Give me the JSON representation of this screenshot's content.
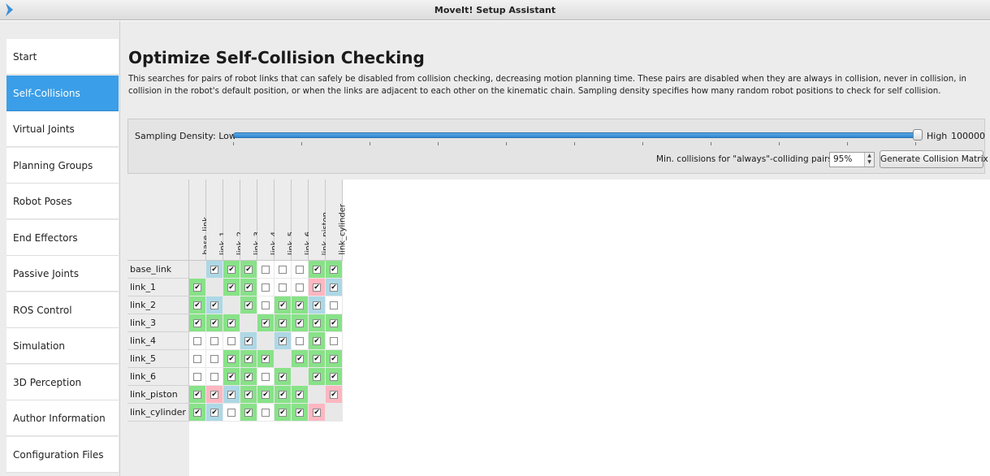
{
  "window": {
    "title": "MoveIt! Setup Assistant",
    "app_icon": "chevron-right-icon",
    "icon_color": "#3b8fd6"
  },
  "sidebar": {
    "items": [
      {
        "label": "Start",
        "active": false
      },
      {
        "label": "Self-Collisions",
        "active": true
      },
      {
        "label": "Virtual Joints",
        "active": false
      },
      {
        "label": "Planning Groups",
        "active": false
      },
      {
        "label": "Robot Poses",
        "active": false
      },
      {
        "label": "End Effectors",
        "active": false
      },
      {
        "label": "Passive Joints",
        "active": false
      },
      {
        "label": "ROS Control",
        "active": false
      },
      {
        "label": "Simulation",
        "active": false
      },
      {
        "label": "3D Perception",
        "active": false
      },
      {
        "label": "Author Information",
        "active": false
      },
      {
        "label": "Configuration Files",
        "active": false
      }
    ],
    "active_color": "#3b9ee8"
  },
  "main": {
    "title": "Optimize Self-Collision Checking",
    "description": "This searches for pairs of robot links that can safely be disabled from collision checking, decreasing motion planning time. These pairs are disabled when they are always in collision, never in collision, in collision in the robot's default position, or when the links are adjacent to each other on the kinematic chain. Sampling density specifies how many random robot positions to check for self collision.",
    "density": {
      "label": "Sampling Density: Low",
      "high_label": "High",
      "value": "100000",
      "slider_fraction": 1.0
    },
    "min_collisions": {
      "label": "Min. collisions for \"always\"-colliding pairs:",
      "value": "95%"
    },
    "generate_button": "Generate Collision Matrix"
  },
  "matrix": {
    "links": [
      "base_link",
      "link_1",
      "link_2",
      "link_3",
      "link_4",
      "link_5",
      "link_6",
      "link_piston",
      "link_cylinder"
    ],
    "colors": {
      "A": "#88e288",
      "N": "#ffffff",
      "D": "#add8e6",
      "C": "#ffb6c1",
      "X": "#e8e8e8"
    },
    "cells": [
      [
        "X",
        "DC",
        "AC",
        "AC",
        "N",
        "N",
        "N",
        "AC",
        "AC"
      ],
      [
        "AC",
        "X",
        "AC",
        "AC",
        "N",
        "N",
        "N",
        "CC",
        "DC"
      ],
      [
        "AC",
        "DC",
        "X",
        "AC",
        "N",
        "AC",
        "AC",
        "DC",
        "N"
      ],
      [
        "AC",
        "AC",
        "AC",
        "X",
        "AC",
        "AC",
        "AC",
        "AC",
        "AC"
      ],
      [
        "N",
        "N",
        "N",
        "DC",
        "X",
        "DC",
        "N",
        "AC",
        "N"
      ],
      [
        "N",
        "N",
        "AC",
        "AC",
        "AC",
        "X",
        "AC",
        "AC",
        "AC"
      ],
      [
        "N",
        "N",
        "AC",
        "AC",
        "N",
        "AC",
        "X",
        "AC",
        "AC"
      ],
      [
        "AC",
        "CC",
        "DC",
        "AC",
        "AC",
        "AC",
        "AC",
        "X",
        "CC"
      ],
      [
        "AC",
        "DC",
        "N",
        "AC",
        "N",
        "AC",
        "AC",
        "CC",
        "X"
      ]
    ]
  }
}
